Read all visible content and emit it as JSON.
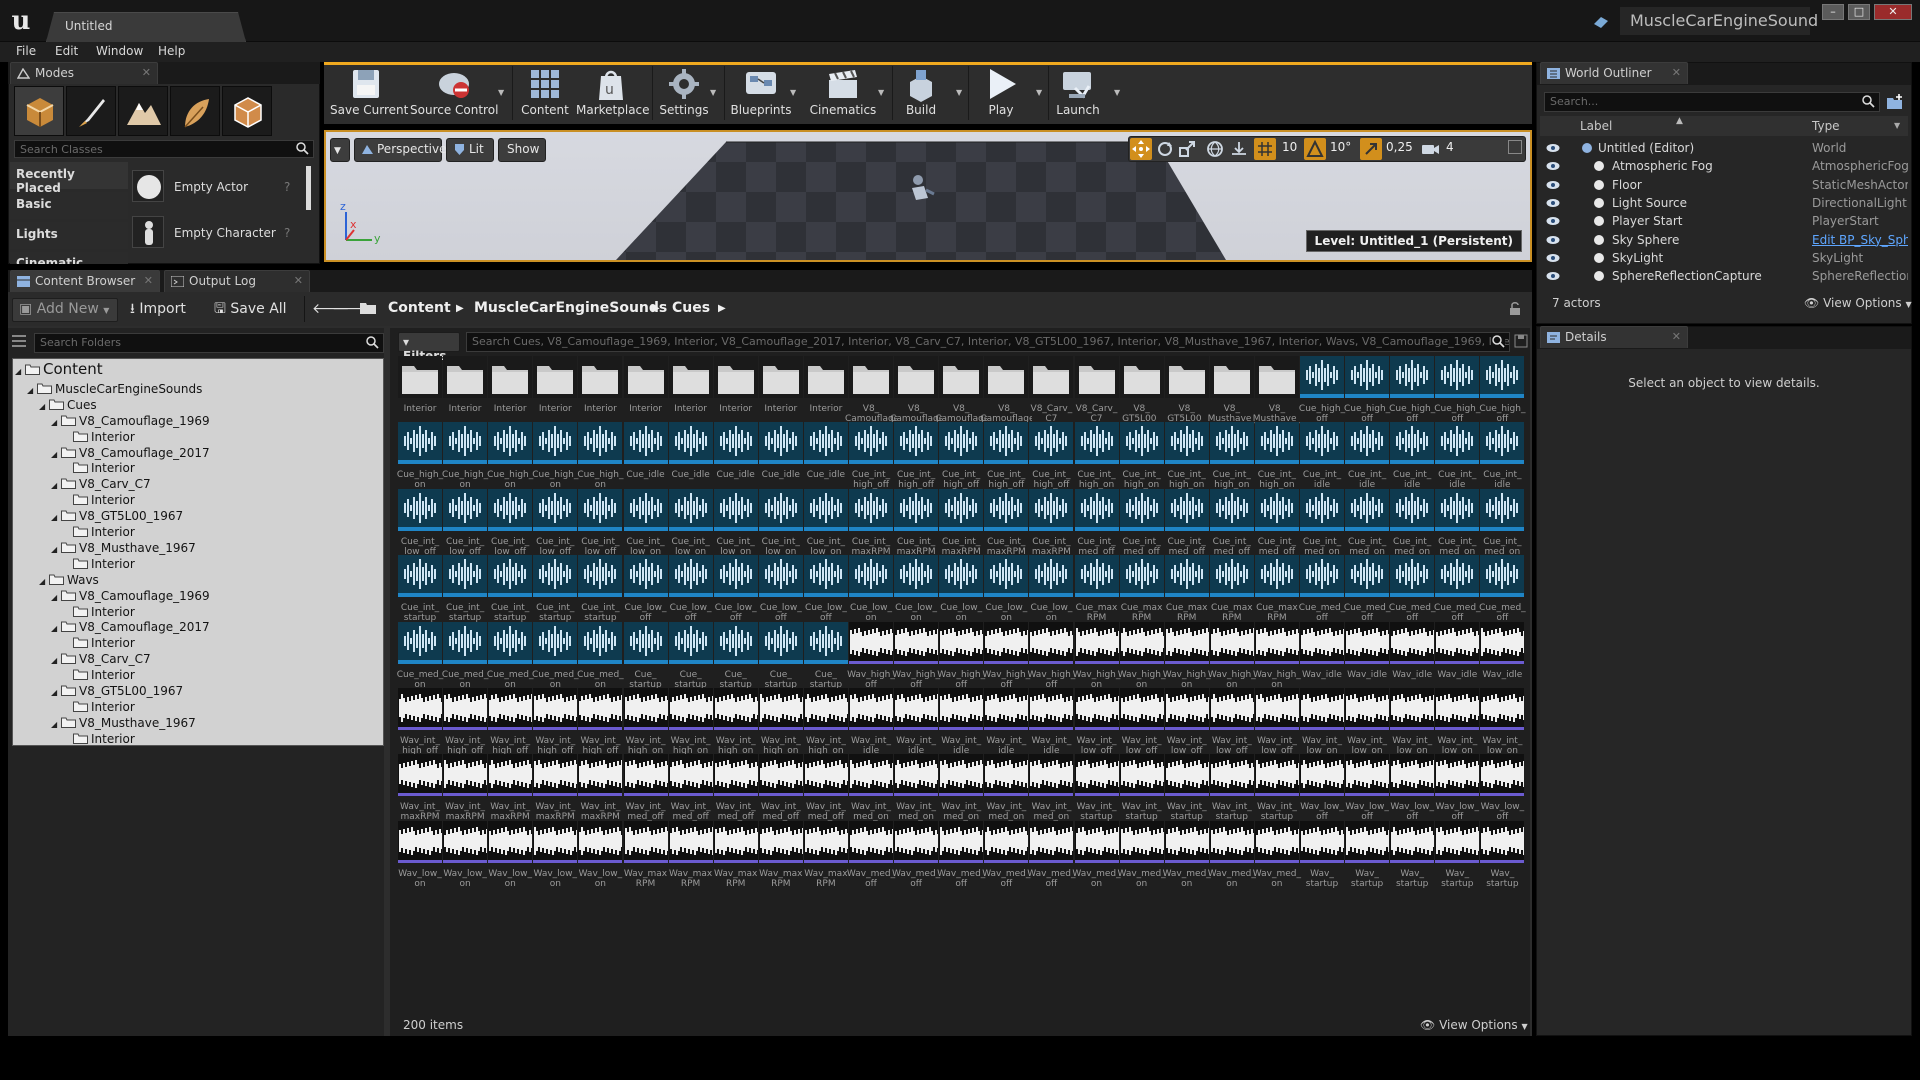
{
  "window": {
    "doc_tab": "Untitled",
    "project_name": "MuscleCarEngineSound",
    "controls": [
      "–",
      "□",
      "✕"
    ]
  },
  "menu": [
    "File",
    "Edit",
    "Window",
    "Help"
  ],
  "modes": {
    "tab_label": "Modes",
    "search_placeholder": "Search Classes",
    "categories": [
      "Recently Placed",
      "Basic",
      "Lights",
      "Cinematic"
    ],
    "items": [
      {
        "label": "Empty Actor"
      },
      {
        "label": "Empty Character"
      }
    ]
  },
  "toolbar": {
    "buttons": [
      "Save Current",
      "Source Control",
      "Content",
      "Marketplace",
      "Settings",
      "Blueprints",
      "Cinematics",
      "Build",
      "Play",
      "Launch"
    ]
  },
  "viewport": {
    "perspective": "Perspective",
    "lit": "Lit",
    "show": "Show",
    "grid_snap": "10",
    "rot_snap": "10°",
    "scale_snap": "0,25",
    "cam_speed": "4",
    "level": "Level:  Untitled_1 (Persistent)",
    "axis_x": "x",
    "axis_y": "y",
    "axis_z": "z"
  },
  "content_browser": {
    "tabs": [
      "Content Browser",
      "Output Log"
    ],
    "add_new": "Add New",
    "import": "Import",
    "save_all": "Save All",
    "breadcrumb": [
      "Content",
      "MuscleCarEngineSounds",
      "Cues"
    ],
    "folder_search_placeholder": "Search Folders",
    "filters": "Filters",
    "asset_search": "Search Cues, V8_Camouflage_1969, Interior, V8_Camouflage_2017, Interior, V8_Carv_C7, Interior, V8_GT5L00_1967, Interior, V8_Musthave_1967, Interior, Wavs, V8_Camouflage_1969, Interior",
    "items_count": "200 items",
    "view_options": "View Options",
    "tree": [
      {
        "label": "Content",
        "depth": 0,
        "expanded": true
      },
      {
        "label": "MuscleCarEngineSounds",
        "depth": 1,
        "expanded": true
      },
      {
        "label": "Cues",
        "depth": 2,
        "expanded": true
      },
      {
        "label": "V8_Camouflage_1969",
        "depth": 3,
        "expanded": true
      },
      {
        "label": "Interior",
        "depth": 4,
        "expanded": false
      },
      {
        "label": "V8_Camouflage_2017",
        "depth": 3,
        "expanded": true
      },
      {
        "label": "Interior",
        "depth": 4,
        "expanded": false
      },
      {
        "label": "V8_Carv_C7",
        "depth": 3,
        "expanded": true
      },
      {
        "label": "Interior",
        "depth": 4,
        "expanded": false
      },
      {
        "label": "V8_GT5L00_1967",
        "depth": 3,
        "expanded": true
      },
      {
        "label": "Interior",
        "depth": 4,
        "expanded": false
      },
      {
        "label": "V8_Musthave_1967",
        "depth": 3,
        "expanded": true
      },
      {
        "label": "Interior",
        "depth": 4,
        "expanded": false
      },
      {
        "label": "Wavs",
        "depth": 2,
        "expanded": true
      },
      {
        "label": "V8_Camouflage_1969",
        "depth": 3,
        "expanded": true
      },
      {
        "label": "Interior",
        "depth": 4,
        "expanded": false
      },
      {
        "label": "V8_Camouflage_2017",
        "depth": 3,
        "expanded": true
      },
      {
        "label": "Interior",
        "depth": 4,
        "expanded": false
      },
      {
        "label": "V8_Carv_C7",
        "depth": 3,
        "expanded": true
      },
      {
        "label": "Interior",
        "depth": 4,
        "expanded": false
      },
      {
        "label": "V8_GT5L00_1967",
        "depth": 3,
        "expanded": true
      },
      {
        "label": "Interior",
        "depth": 4,
        "expanded": false
      },
      {
        "label": "V8_Musthave_1967",
        "depth": 3,
        "expanded": true
      },
      {
        "label": "Interior",
        "depth": 4,
        "expanded": false
      }
    ],
    "asset_rows": [
      [
        [
          "folder",
          "Interior"
        ],
        [
          "folder",
          "Interior"
        ],
        [
          "folder",
          "Interior"
        ],
        [
          "folder",
          "Interior"
        ],
        [
          "folder",
          "Interior"
        ],
        [
          "folder",
          "Interior"
        ],
        [
          "folder",
          "Interior"
        ],
        [
          "folder",
          "Interior"
        ],
        [
          "folder",
          "Interior"
        ],
        [
          "folder",
          "Interior"
        ],
        [
          "folder",
          "V8_ Camouflage _1969"
        ],
        [
          "folder",
          "V8_ Camouflage _1969"
        ],
        [
          "folder",
          "V8_ Camouflage _2017"
        ],
        [
          "folder",
          "V8_ Camouflage _2017"
        ],
        [
          "folder",
          "V8_Carv_ C7"
        ],
        [
          "folder",
          "V8_Carv_ C7"
        ],
        [
          "folder",
          "V8_ GT5L00_ 1967"
        ],
        [
          "folder",
          "V8_ GT5L00_ 1967"
        ],
        [
          "folder",
          "V8_ Musthave_ 1967"
        ],
        [
          "folder",
          "V8_ Musthave_ 1967"
        ],
        [
          "cue",
          "Cue_high_ off"
        ],
        [
          "cue",
          "Cue_high_ off"
        ],
        [
          "cue",
          "Cue_high_ off"
        ],
        [
          "cue",
          "Cue_high_ off"
        ],
        [
          "cue",
          "Cue_high_ off"
        ]
      ],
      [
        [
          "cue",
          "Cue_high_ on"
        ],
        [
          "cue",
          "Cue_high_ on"
        ],
        [
          "cue",
          "Cue_high_ on"
        ],
        [
          "cue",
          "Cue_high_ on"
        ],
        [
          "cue",
          "Cue_high_ on"
        ],
        [
          "cue",
          "Cue_idle"
        ],
        [
          "cue",
          "Cue_idle"
        ],
        [
          "cue",
          "Cue_idle"
        ],
        [
          "cue",
          "Cue_idle"
        ],
        [
          "cue",
          "Cue_idle"
        ],
        [
          "cue",
          "Cue_int_ high_off"
        ],
        [
          "cue",
          "Cue_int_ high_off"
        ],
        [
          "cue",
          "Cue_int_ high_off"
        ],
        [
          "cue",
          "Cue_int_ high_off"
        ],
        [
          "cue",
          "Cue_int_ high_off"
        ],
        [
          "cue",
          "Cue_int_ high_on"
        ],
        [
          "cue",
          "Cue_int_ high_on"
        ],
        [
          "cue",
          "Cue_int_ high_on"
        ],
        [
          "cue",
          "Cue_int_ high_on"
        ],
        [
          "cue",
          "Cue_int_ high_on"
        ],
        [
          "cue",
          "Cue_int_ idle"
        ],
        [
          "cue",
          "Cue_int_ idle"
        ],
        [
          "cue",
          "Cue_int_ idle"
        ],
        [
          "cue",
          "Cue_int_ idle"
        ],
        [
          "cue",
          "Cue_int_ idle"
        ]
      ],
      [
        [
          "cue",
          "Cue_int_ low_off"
        ],
        [
          "cue",
          "Cue_int_ low_off"
        ],
        [
          "cue",
          "Cue_int_ low_off"
        ],
        [
          "cue",
          "Cue_int_ low_off"
        ],
        [
          "cue",
          "Cue_int_ low_off"
        ],
        [
          "cue",
          "Cue_int_ low_on"
        ],
        [
          "cue",
          "Cue_int_ low_on"
        ],
        [
          "cue",
          "Cue_int_ low_on"
        ],
        [
          "cue",
          "Cue_int_ low_on"
        ],
        [
          "cue",
          "Cue_int_ low_on"
        ],
        [
          "cue",
          "Cue_int_ maxRPM"
        ],
        [
          "cue",
          "Cue_int_ maxRPM"
        ],
        [
          "cue",
          "Cue_int_ maxRPM"
        ],
        [
          "cue",
          "Cue_int_ maxRPM"
        ],
        [
          "cue",
          "Cue_int_ maxRPM"
        ],
        [
          "cue",
          "Cue_int_ med_off"
        ],
        [
          "cue",
          "Cue_int_ med_off"
        ],
        [
          "cue",
          "Cue_int_ med_off"
        ],
        [
          "cue",
          "Cue_int_ med_off"
        ],
        [
          "cue",
          "Cue_int_ med_off"
        ],
        [
          "cue",
          "Cue_int_ med_on"
        ],
        [
          "cue",
          "Cue_int_ med_on"
        ],
        [
          "cue",
          "Cue_int_ med_on"
        ],
        [
          "cue",
          "Cue_int_ med_on"
        ],
        [
          "cue",
          "Cue_int_ med_on"
        ]
      ],
      [
        [
          "cue",
          "Cue_int_ startup"
        ],
        [
          "cue",
          "Cue_int_ startup"
        ],
        [
          "cue",
          "Cue_int_ startup"
        ],
        [
          "cue",
          "Cue_int_ startup"
        ],
        [
          "cue",
          "Cue_int_ startup"
        ],
        [
          "cue",
          "Cue_low_ off"
        ],
        [
          "cue",
          "Cue_low_ off"
        ],
        [
          "cue",
          "Cue_low_ off"
        ],
        [
          "cue",
          "Cue_low_ off"
        ],
        [
          "cue",
          "Cue_low_ off"
        ],
        [
          "cue",
          "Cue_low_ on"
        ],
        [
          "cue",
          "Cue_low_ on"
        ],
        [
          "cue",
          "Cue_low_ on"
        ],
        [
          "cue",
          "Cue_low_ on"
        ],
        [
          "cue",
          "Cue_low_ on"
        ],
        [
          "cue",
          "Cue_max RPM"
        ],
        [
          "cue",
          "Cue_max RPM"
        ],
        [
          "cue",
          "Cue_max RPM"
        ],
        [
          "cue",
          "Cue_max RPM"
        ],
        [
          "cue",
          "Cue_max RPM"
        ],
        [
          "cue",
          "Cue_med_ off"
        ],
        [
          "cue",
          "Cue_med_ off"
        ],
        [
          "cue",
          "Cue_med_ off"
        ],
        [
          "cue",
          "Cue_med_ off"
        ],
        [
          "cue",
          "Cue_med_ off"
        ]
      ],
      [
        [
          "cue",
          "Cue_med_ on"
        ],
        [
          "cue",
          "Cue_med_ on"
        ],
        [
          "cue",
          "Cue_med_ on"
        ],
        [
          "cue",
          "Cue_med_ on"
        ],
        [
          "cue",
          "Cue_med_ on"
        ],
        [
          "cue",
          "Cue_ startup"
        ],
        [
          "cue",
          "Cue_ startup"
        ],
        [
          "cue",
          "Cue_ startup"
        ],
        [
          "cue",
          "Cue_ startup"
        ],
        [
          "cue",
          "Cue_ startup"
        ],
        [
          "wav",
          "Wav_high_ off"
        ],
        [
          "wav",
          "Wav_high_ off"
        ],
        [
          "wav",
          "Wav_high_ off"
        ],
        [
          "wav",
          "Wav_high_ off"
        ],
        [
          "wav",
          "Wav_high_ off"
        ],
        [
          "wav",
          "Wav_high_ on"
        ],
        [
          "wav",
          "Wav_high_ on"
        ],
        [
          "wav",
          "Wav_high_ on"
        ],
        [
          "wav",
          "Wav_high_ on"
        ],
        [
          "wav",
          "Wav_high_ on"
        ],
        [
          "wav",
          "Wav_idle"
        ],
        [
          "wav",
          "Wav_idle"
        ],
        [
          "wav",
          "Wav_idle"
        ],
        [
          "wav",
          "Wav_idle"
        ],
        [
          "wav",
          "Wav_idle"
        ]
      ],
      [
        [
          "wav",
          "Wav_int_ high_off"
        ],
        [
          "wav",
          "Wav_int_ high_off"
        ],
        [
          "wav",
          "Wav_int_ high_off"
        ],
        [
          "wav",
          "Wav_int_ high_off"
        ],
        [
          "wav",
          "Wav_int_ high_off"
        ],
        [
          "wav",
          "Wav_int_ high_on"
        ],
        [
          "wav",
          "Wav_int_ high_on"
        ],
        [
          "wav",
          "Wav_int_ high_on"
        ],
        [
          "wav",
          "Wav_int_ high_on"
        ],
        [
          "wav",
          "Wav_int_ high_on"
        ],
        [
          "wav",
          "Wav_int_ idle"
        ],
        [
          "wav",
          "Wav_int_ idle"
        ],
        [
          "wav",
          "Wav_int_ idle"
        ],
        [
          "wav",
          "Wav_int_ idle"
        ],
        [
          "wav",
          "Wav_int_ idle"
        ],
        [
          "wav",
          "Wav_int_ low_off"
        ],
        [
          "wav",
          "Wav_int_ low_off"
        ],
        [
          "wav",
          "Wav_int_ low_off"
        ],
        [
          "wav",
          "Wav_int_ low_off"
        ],
        [
          "wav",
          "Wav_int_ low_off"
        ],
        [
          "wav",
          "Wav_int_ low_on"
        ],
        [
          "wav",
          "Wav_int_ low_on"
        ],
        [
          "wav",
          "Wav_int_ low_on"
        ],
        [
          "wav",
          "Wav_int_ low_on"
        ],
        [
          "wav",
          "Wav_int_ low_on"
        ]
      ],
      [
        [
          "wav",
          "Wav_int_ maxRPM"
        ],
        [
          "wav",
          "Wav_int_ maxRPM"
        ],
        [
          "wav",
          "Wav_int_ maxRPM"
        ],
        [
          "wav",
          "Wav_int_ maxRPM"
        ],
        [
          "wav",
          "Wav_int_ maxRPM"
        ],
        [
          "wav",
          "Wav_int_ med_off"
        ],
        [
          "wav",
          "Wav_int_ med_off"
        ],
        [
          "wav",
          "Wav_int_ med_off"
        ],
        [
          "wav",
          "Wav_int_ med_off"
        ],
        [
          "wav",
          "Wav_int_ med_off"
        ],
        [
          "wav",
          "Wav_int_ med_on"
        ],
        [
          "wav",
          "Wav_int_ med_on"
        ],
        [
          "wav",
          "Wav_int_ med_on"
        ],
        [
          "wav",
          "Wav_int_ med_on"
        ],
        [
          "wav",
          "Wav_int_ med_on"
        ],
        [
          "wav",
          "Wav_int_ startup"
        ],
        [
          "wav",
          "Wav_int_ startup"
        ],
        [
          "wav",
          "Wav_int_ startup"
        ],
        [
          "wav",
          "Wav_int_ startup"
        ],
        [
          "wav",
          "Wav_int_ startup"
        ],
        [
          "wav",
          "Wav_low_ off"
        ],
        [
          "wav",
          "Wav_low_ off"
        ],
        [
          "wav",
          "Wav_low_ off"
        ],
        [
          "wav",
          "Wav_low_ off"
        ],
        [
          "wav",
          "Wav_low_ off"
        ]
      ],
      [
        [
          "wav",
          "Wav_low_ on"
        ],
        [
          "wav",
          "Wav_low_ on"
        ],
        [
          "wav",
          "Wav_low_ on"
        ],
        [
          "wav",
          "Wav_low_ on"
        ],
        [
          "wav",
          "Wav_low_ on"
        ],
        [
          "wav",
          "Wav_max RPM"
        ],
        [
          "wav",
          "Wav_max RPM"
        ],
        [
          "wav",
          "Wav_max RPM"
        ],
        [
          "wav",
          "Wav_max RPM"
        ],
        [
          "wav",
          "Wav_max RPM"
        ],
        [
          "wav",
          "Wav_med_ off"
        ],
        [
          "wav",
          "Wav_med_ off"
        ],
        [
          "wav",
          "Wav_med_ off"
        ],
        [
          "wav",
          "Wav_med_ off"
        ],
        [
          "wav",
          "Wav_med_ off"
        ],
        [
          "wav",
          "Wav_med_ on"
        ],
        [
          "wav",
          "Wav_med_ on"
        ],
        [
          "wav",
          "Wav_med_ on"
        ],
        [
          "wav",
          "Wav_med_ on"
        ],
        [
          "wav",
          "Wav_med_ on"
        ],
        [
          "wav",
          "Wav_ startup"
        ],
        [
          "wav",
          "Wav_ startup"
        ],
        [
          "wav",
          "Wav_ startup"
        ],
        [
          "wav",
          "Wav_ startup"
        ],
        [
          "wav",
          "Wav_ startup"
        ]
      ]
    ]
  },
  "world_outliner": {
    "tab_label": "World Outliner",
    "search_placeholder": "Search...",
    "col_label": "Label",
    "col_type": "Type",
    "rows": [
      {
        "label": "Untitled (Editor)",
        "type": "World"
      },
      {
        "label": "Atmospheric Fog",
        "type": "AtmosphericFog"
      },
      {
        "label": "Floor",
        "type": "StaticMeshActor"
      },
      {
        "label": "Light Source",
        "type": "DirectionalLight"
      },
      {
        "label": "Player Start",
        "type": "PlayerStart"
      },
      {
        "label": "Sky Sphere",
        "type": "Edit BP_Sky_Sphere"
      },
      {
        "label": "SkyLight",
        "type": "SkyLight"
      },
      {
        "label": "SphereReflectionCapture",
        "type": "SphereReflectionC"
      }
    ],
    "actor_count": "7 actors",
    "view_options": "View Options"
  },
  "details": {
    "tab_label": "Details",
    "empty_text": "Select an object to view details."
  },
  "colors": {
    "accent": "#f0a91f",
    "cue_thumb": "#0e3a4f",
    "cue_bar": "#1f85c6",
    "wav_bar": "#6b5bd0",
    "link": "#5ea6ff"
  }
}
